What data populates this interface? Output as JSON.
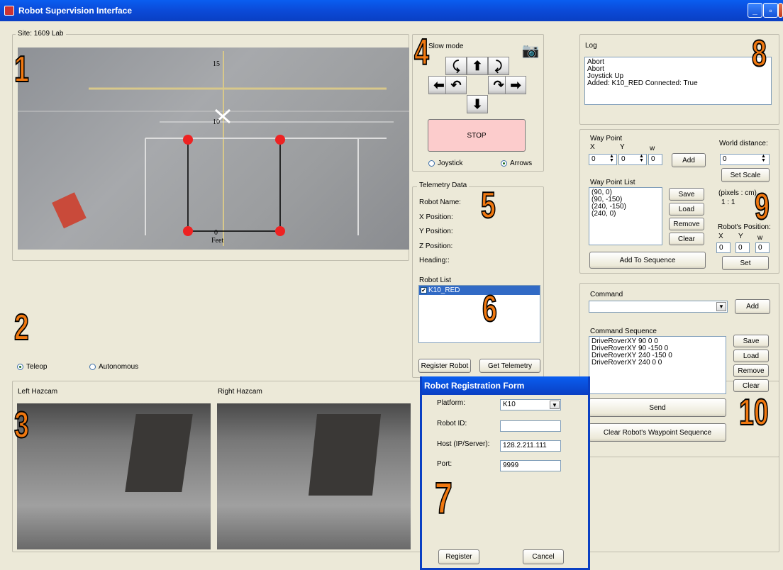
{
  "window": {
    "title": "Robot Supervision Interface",
    "min": "_",
    "max": "▫",
    "close": "X"
  },
  "badges": [
    "1",
    "2",
    "3",
    "4",
    "5",
    "6",
    "7",
    "8",
    "9",
    "10"
  ],
  "site": {
    "label": "Site: 1609 Lab",
    "ticks": [
      "15",
      "10",
      "0"
    ],
    "feet_label": "Feet"
  },
  "mode": {
    "teleop": "Teleop",
    "autonomous": "Autonomous",
    "selected": "Teleop"
  },
  "hazcam": {
    "left": "Left Hazcam",
    "right": "Right Hazcam"
  },
  "drive": {
    "slow_mode": "Slow mode",
    "stop": "STOP",
    "joystick": "Joystick",
    "arrows": "Arrows",
    "selected": "Arrows",
    "stop_color": "#fccccc"
  },
  "telemetry": {
    "title": "Telemetry Data",
    "robot_name": "Robot Name:",
    "x": "X Position:",
    "y": "Y Position:",
    "z": "Z Position:",
    "heading": "Heading::"
  },
  "robots": {
    "title": "Robot List",
    "items": [
      "K10_RED"
    ],
    "register": "Register Robot",
    "get_telemetry": "Get Telemetry"
  },
  "log": {
    "title": "Log",
    "lines": [
      "Abort",
      "Abort",
      "Joystick Up",
      "Added: K10_RED  Connected: True"
    ]
  },
  "waypoint": {
    "title": "Way Point",
    "x_label": "X",
    "y_label": "Y",
    "w_label": "w",
    "x": "0",
    "y": "0",
    "w": "0",
    "add": "Add",
    "list_title": "Way Point List",
    "list": [
      "(90, 0)",
      "(90, -150)",
      "(240, -150)",
      "(240, 0)"
    ],
    "save": "Save",
    "load": "Load",
    "remove": "Remove",
    "clear": "Clear",
    "add_to_sequence": "Add To Sequence",
    "world_distance": "World distance:",
    "world_value": "0",
    "set_scale": "Set Scale",
    "scale_label": "(pixels : cm)",
    "scale": "1 : 1",
    "robot_position": "Robot's Position:",
    "rx": "0",
    "ry": "0",
    "rw": "0",
    "set": "Set"
  },
  "command": {
    "title": "Command",
    "value": "",
    "add": "Add",
    "seq_title": "Command Sequence",
    "sequence": [
      "DriveRoverXY  90 0 0",
      "DriveRoverXY  90 -150 0",
      "DriveRoverXY  240 -150 0",
      "DriveRoverXY  240 0 0"
    ],
    "save": "Save",
    "load": "Load",
    "remove": "Remove",
    "clear": "Clear",
    "send": "Send",
    "clear_waypoints": "Clear Robot's Waypoint Sequence"
  },
  "registration": {
    "title": "Robot Registration Form",
    "platform_label": "Platform:",
    "platform": "K10",
    "robot_id_label": "Robot ID:",
    "robot_id": "",
    "host_label": "Host (IP/Server):",
    "host": "128.2.211.111",
    "port_label": "Port:",
    "port": "9999",
    "register": "Register",
    "cancel": "Cancel"
  }
}
